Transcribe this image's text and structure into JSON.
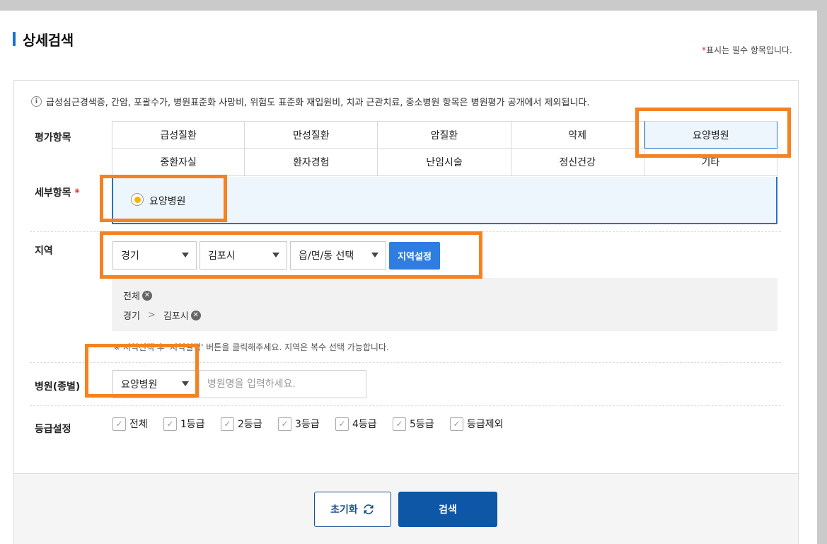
{
  "header": {
    "title": "상세검색",
    "required_star": "*",
    "required_note": "표시는 필수 항목입니다."
  },
  "info_note": "급성심근경색증, 간암, 포괄수가, 병원표준화 사망비, 위험도 표준화 재입원비, 치과 근관치료, 중소병원 항목은 병원평가 공개에서 제외됩니다.",
  "labels": {
    "eval_items": "평가항목",
    "detail_items": "세부항목",
    "region": "지역",
    "hospital_type": "병원(종별)",
    "grade": "등급설정"
  },
  "eval_tabs": {
    "row1": [
      "급성질환",
      "만성질환",
      "암질환",
      "약제",
      "요양병원"
    ],
    "row2": [
      "중환자실",
      "환자경험",
      "난임시술",
      "정신건강",
      "기타"
    ],
    "active": "요양병원"
  },
  "detail": {
    "selected_option": "요양병원"
  },
  "region": {
    "sido": "경기",
    "sigungu": "김포시",
    "emd": "읍/면/동 선택",
    "set_button": "지역설정",
    "chip_all": "전체",
    "chip_path_1": "경기",
    "chip_path_sep": ">",
    "chip_path_2": "김포시",
    "note": "※ 지역선택 후 '지역설정' 버튼을 클릭해주세요. 지역은 복수 선택 가능합니다."
  },
  "hospital": {
    "type_selected": "요양병원",
    "name_placeholder": "병원명을 입력하세요."
  },
  "grades": [
    "전체",
    "1등급",
    "2등급",
    "3등급",
    "4등급",
    "5등급",
    "등급제외"
  ],
  "buttons": {
    "reset": "초기화",
    "search": "검색"
  },
  "colors": {
    "accent_blue": "#2f7de1",
    "search_button": "#0e56a6",
    "highlight_orange": "#f58220",
    "radio_selected": "#f5b400",
    "required_red": "#e0312b"
  }
}
